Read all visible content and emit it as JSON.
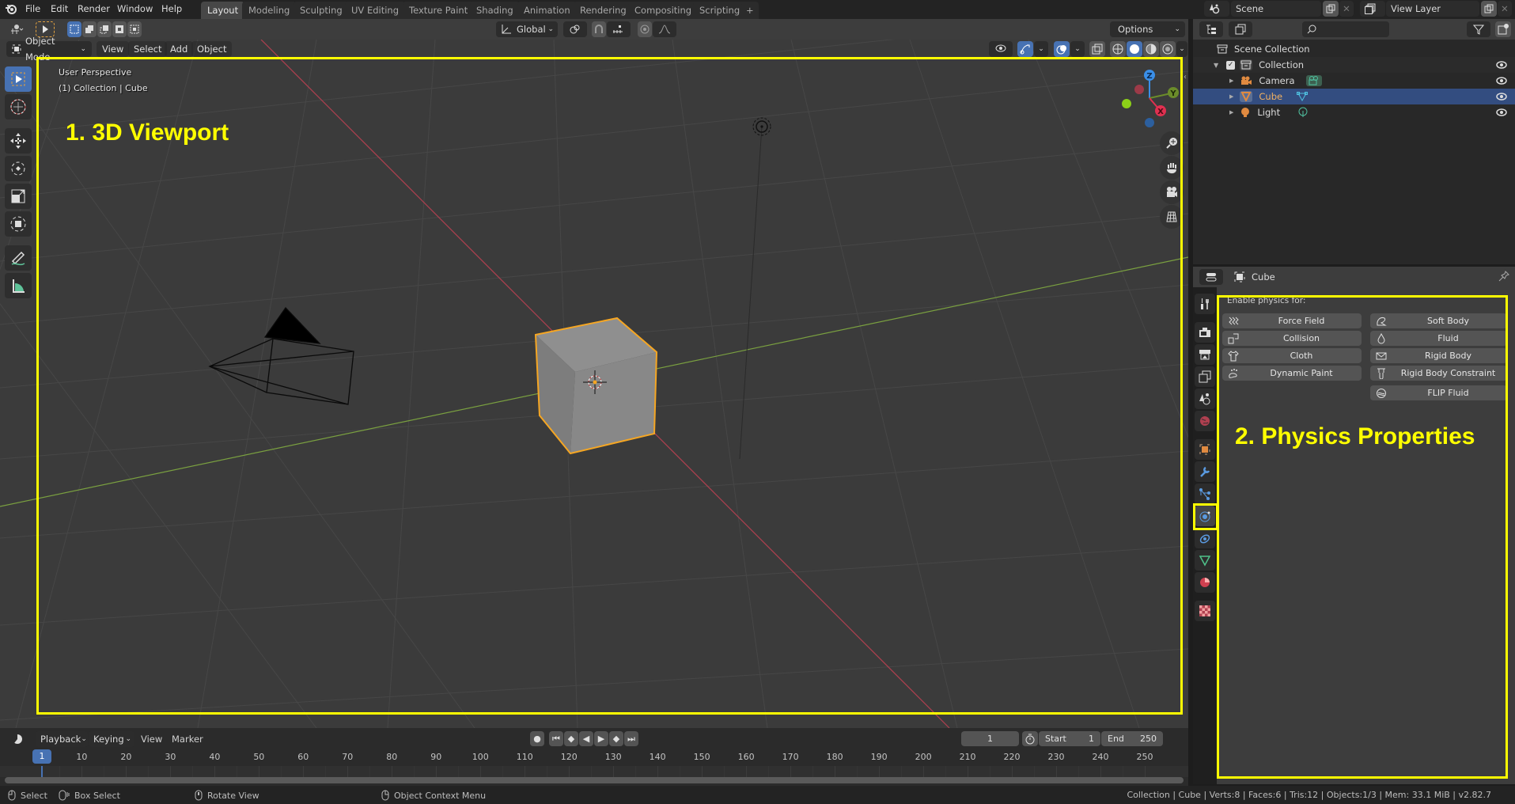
{
  "app": {
    "menu": [
      "File",
      "Edit",
      "Render",
      "Window",
      "Help"
    ],
    "workspace_tabs": [
      "Layout",
      "Modeling",
      "Sculpting",
      "UV Editing",
      "Texture Paint",
      "Shading",
      "Animation",
      "Rendering",
      "Compositing",
      "Scripting"
    ],
    "active_workspace": "Layout",
    "add_workspace_label": "+",
    "scene_name": "Scene",
    "view_layer_name": "View Layer"
  },
  "tool_header": {
    "transform_orientation": "Global",
    "options_label": "Options"
  },
  "viewport": {
    "mode": "Object Mode",
    "menus": [
      "View",
      "Select",
      "Add",
      "Object"
    ],
    "perspective_label": "User Perspective",
    "context_label": "(1) Collection | Cube",
    "gizmo_axes": {
      "z": "Z",
      "y": "Y",
      "x": "X"
    },
    "annotation": "1. 3D Viewport",
    "colors": {
      "annotation": "#ffff00",
      "selected_outline": "#f5a623",
      "x_axis": "#d04050",
      "y_axis": "#8bc34a"
    }
  },
  "outliner": {
    "search_placeholder": "",
    "scene_collection": "Scene Collection",
    "items": [
      {
        "name": "Collection",
        "type": "collection",
        "checked": true,
        "visible": true
      },
      {
        "name": "Camera",
        "type": "camera",
        "visible": true
      },
      {
        "name": "Cube",
        "type": "mesh",
        "selected": true,
        "visible": true
      },
      {
        "name": "Light",
        "type": "light",
        "visible": true
      }
    ]
  },
  "properties": {
    "object_name": "Cube",
    "section_label": "Enable physics for:",
    "active_tab": "physics",
    "tabs": [
      "tool",
      "render",
      "output",
      "view-layer",
      "scene",
      "world",
      "object",
      "modifiers",
      "particles",
      "physics",
      "constraints",
      "data",
      "material",
      "texture"
    ],
    "left_buttons": [
      {
        "label": "Force Field",
        "icon": "force-field-icon"
      },
      {
        "label": "Collision",
        "icon": "collision-icon"
      },
      {
        "label": "Cloth",
        "icon": "cloth-icon"
      },
      {
        "label": "Dynamic Paint",
        "icon": "dynamic-paint-icon"
      }
    ],
    "right_buttons": [
      {
        "label": "Soft Body",
        "icon": "soft-body-icon"
      },
      {
        "label": "Fluid",
        "icon": "fluid-icon"
      },
      {
        "label": "Rigid Body",
        "icon": "rigid-body-icon"
      },
      {
        "label": "Rigid Body Constraint",
        "icon": "rigid-body-constraint-icon"
      },
      {
        "label": "FLIP Fluid",
        "icon": "flip-fluid-icon"
      }
    ],
    "annotation": "2. Physics Properties"
  },
  "timeline": {
    "menus": [
      "Playback",
      "Keying",
      "View",
      "Marker"
    ],
    "current_frame": "1",
    "start_label": "Start",
    "start": "1",
    "end_label": "End",
    "end": "250",
    "ruler_labels": [
      "10",
      "20",
      "30",
      "40",
      "50",
      "60",
      "70",
      "80",
      "90",
      "100",
      "110",
      "120",
      "130",
      "140",
      "150",
      "160",
      "170",
      "180",
      "190",
      "200",
      "210",
      "220",
      "230",
      "240",
      "250"
    ],
    "playhead_label": "1"
  },
  "statusbar": {
    "select": "Select",
    "box_select": "Box Select",
    "rotate_view": "Rotate View",
    "context_menu": "Object Context Menu",
    "stats": "Collection | Cube | Verts:8 | Faces:6 | Tris:12 | Objects:1/3 | Mem: 33.1 MiB | v2.82.7"
  }
}
